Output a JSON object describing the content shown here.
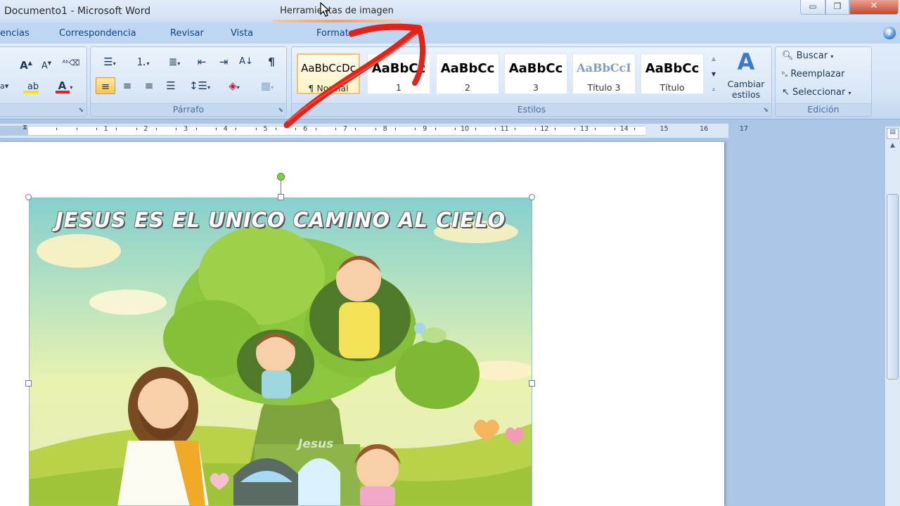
{
  "window": {
    "title": "Documento1 - Microsoft Word",
    "context_tab_title": "Herramientas de imagen",
    "minimize": "▭",
    "maximize": "❐",
    "close": "✕"
  },
  "tabs": [
    {
      "label": "encias"
    },
    {
      "label": "Correspondencia"
    },
    {
      "label": "Revisar"
    },
    {
      "label": "Vista"
    },
    {
      "label": "Formato"
    }
  ],
  "help_label": "?",
  "ribbon": {
    "parrafo_label": "Párrafo",
    "estilos_label": "Estilos",
    "edicion_label": "Edición",
    "pilcrow": "¶",
    "styles": [
      {
        "sample": "AaBbCcDc",
        "name": "¶ Normal"
      },
      {
        "sample": "AaBbCc",
        "name": "1"
      },
      {
        "sample": "AaBbCc",
        "name": "2"
      },
      {
        "sample": "AaBbCc",
        "name": "3"
      },
      {
        "sample": "AaBbCcI",
        "name": "Título 3"
      },
      {
        "sample": "AaBbCc",
        "name": "Título"
      }
    ],
    "change_styles": "Cambiar estilos",
    "editing": {
      "find": "Buscar",
      "replace": "Reemplazar",
      "select": "Seleccionar"
    }
  },
  "ruler_numbers": [
    "1",
    "1",
    "2",
    "3",
    "4",
    "5",
    "6",
    "7",
    "8",
    "9",
    "10",
    "11",
    "12",
    "13",
    "14",
    "15",
    "16",
    "17"
  ],
  "document": {
    "picture_title": "JESUS ES EL UNICO CAMINO AL CIELO",
    "tree_label": "Jesus"
  },
  "colors": {
    "annotation_arrow": "#e2231a",
    "font_color_bar": "#e2231a",
    "highlight_bar": "#f7e400",
    "active_button": "#f9c750"
  }
}
